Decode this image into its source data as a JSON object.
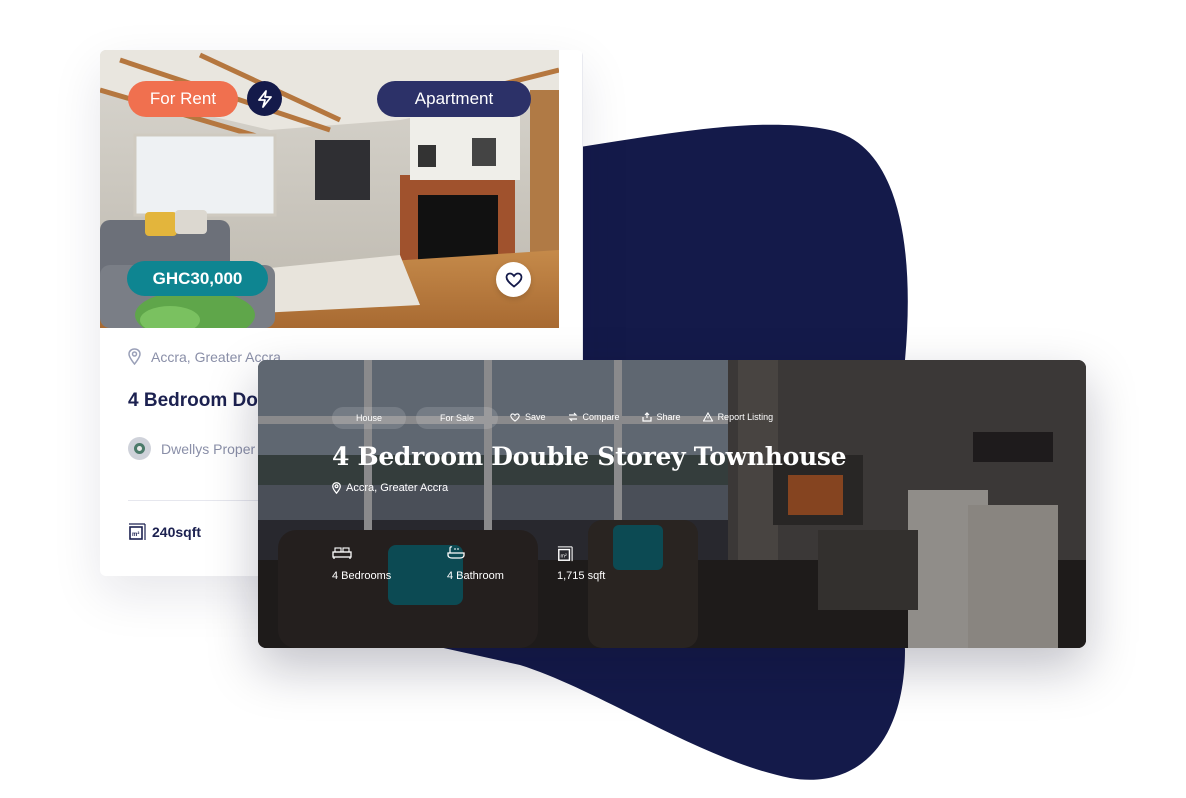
{
  "colors": {
    "navy": "#141a4a",
    "rent_pill": "#f0704f",
    "type_pill": "#2c3168",
    "price_pill": "#0e8591"
  },
  "listing_card": {
    "status_label": "For Rent",
    "flash_icon": "lightning-bolt-icon",
    "type_label": "Apartment",
    "price": "GHC30,000",
    "favorite_icon": "heart-icon",
    "location": "Accra, Greater Accra",
    "title": "4 Bedroom Do",
    "agent_name": "Dwellys Proper",
    "area": "240sqft"
  },
  "detail_banner": {
    "tags": [
      "House",
      "For Sale"
    ],
    "actions": [
      {
        "label": "Save",
        "icon": "heart-icon"
      },
      {
        "label": "Compare",
        "icon": "compare-icon"
      },
      {
        "label": "Share",
        "icon": "share-icon"
      },
      {
        "label": "Report Listing",
        "icon": "warning-icon"
      }
    ],
    "title": "4 Bedroom Double Storey Townhouse",
    "location": "Accra, Greater Accra",
    "features": [
      {
        "label": "4 Bedrooms",
        "icon": "bed-icon"
      },
      {
        "label": "4 Bathroom",
        "icon": "bathtub-icon"
      },
      {
        "label": "1,715 sqft",
        "icon": "area-icon"
      }
    ]
  }
}
